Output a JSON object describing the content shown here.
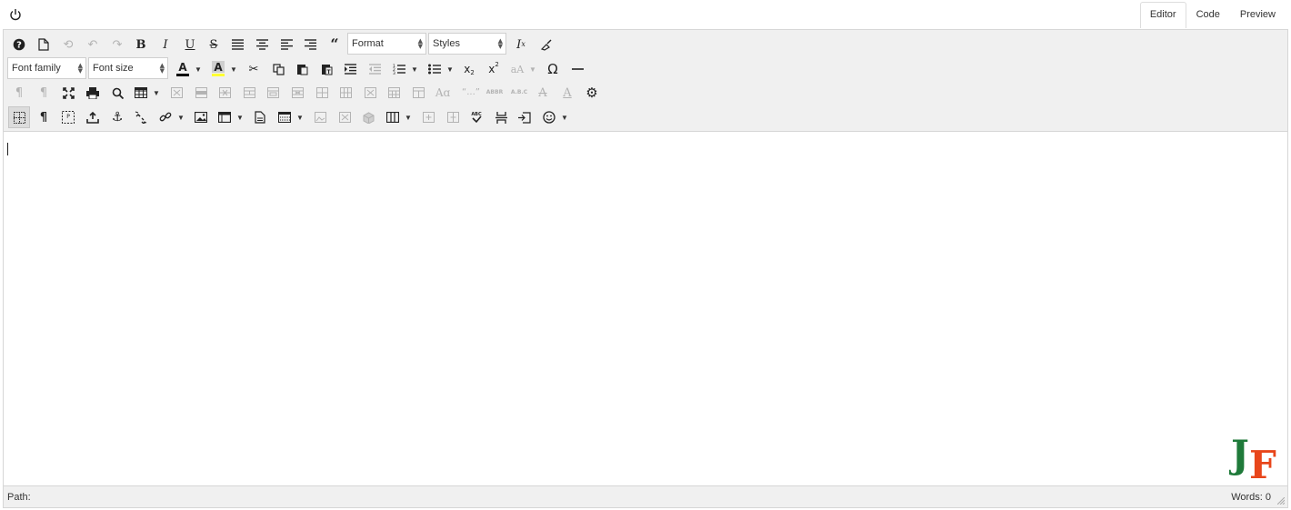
{
  "topbar": {
    "power_icon": "power-icon",
    "tabs": [
      {
        "label": "Editor",
        "active": true
      },
      {
        "label": "Code",
        "active": false
      },
      {
        "label": "Preview",
        "active": false
      }
    ]
  },
  "toolbar": {
    "format_select": "Format",
    "styles_select": "Styles",
    "font_family_select": "Font family",
    "font_size_select": "Font size",
    "text_color_swatch": "#000000",
    "bg_color_swatch": "#ffff00",
    "icons_row1": [
      "help-icon",
      "new-document-icon",
      "restore-draft-icon",
      "undo-icon",
      "redo-icon",
      "bold-icon",
      "italic-icon",
      "underline-icon",
      "strikethrough-icon",
      "align-justify-icon",
      "align-center-icon",
      "align-left-icon",
      "align-right-icon",
      "blockquote-icon",
      "clear-formatting-icon",
      "format-painter-icon"
    ],
    "icons_row2": [
      "text-color-icon",
      "background-color-icon",
      "cut-icon",
      "copy-icon",
      "paste-icon",
      "paste-text-icon",
      "indent-icon",
      "outdent-icon",
      "numbered-list-icon",
      "bullet-list-icon",
      "subscript-icon",
      "superscript-icon",
      "case-change-icon",
      "special-character-icon",
      "horizontal-line-icon"
    ],
    "icons_row3": [
      "ltr-icon",
      "rtl-icon",
      "fullscreen-icon",
      "print-icon",
      "search-icon",
      "table-icon",
      "delete-table-icon",
      "row-insert-icon",
      "row-delete-icon",
      "row-props-icon",
      "cell-props-icon",
      "merge-cells-icon",
      "split-cell-icon",
      "col-delete-icon",
      "table-props-icon",
      "col-props-icon",
      "font-style-icon",
      "quote-icon",
      "abbr-icon",
      "acronym-icon",
      "strike-format-icon",
      "font-icon",
      "settings-icon"
    ],
    "icons_row4": [
      "visual-aid-icon",
      "paragraph-marks-icon",
      "visual-blocks-icon",
      "upload-icon",
      "anchor-icon",
      "unlink-icon",
      "link-icon",
      "image-icon",
      "media-icon",
      "template-icon",
      "table-grid-icon",
      "image-edit-icon",
      "image-crop-icon",
      "3d-box-icon",
      "columns-icon",
      "insert-col-icon",
      "insert-row-icon",
      "spellcheck-icon",
      "page-break-icon",
      "nonbreaking-icon",
      "emoticons-icon"
    ]
  },
  "statusbar": {
    "path_label": "Path:",
    "words_label": "Words: 0"
  }
}
